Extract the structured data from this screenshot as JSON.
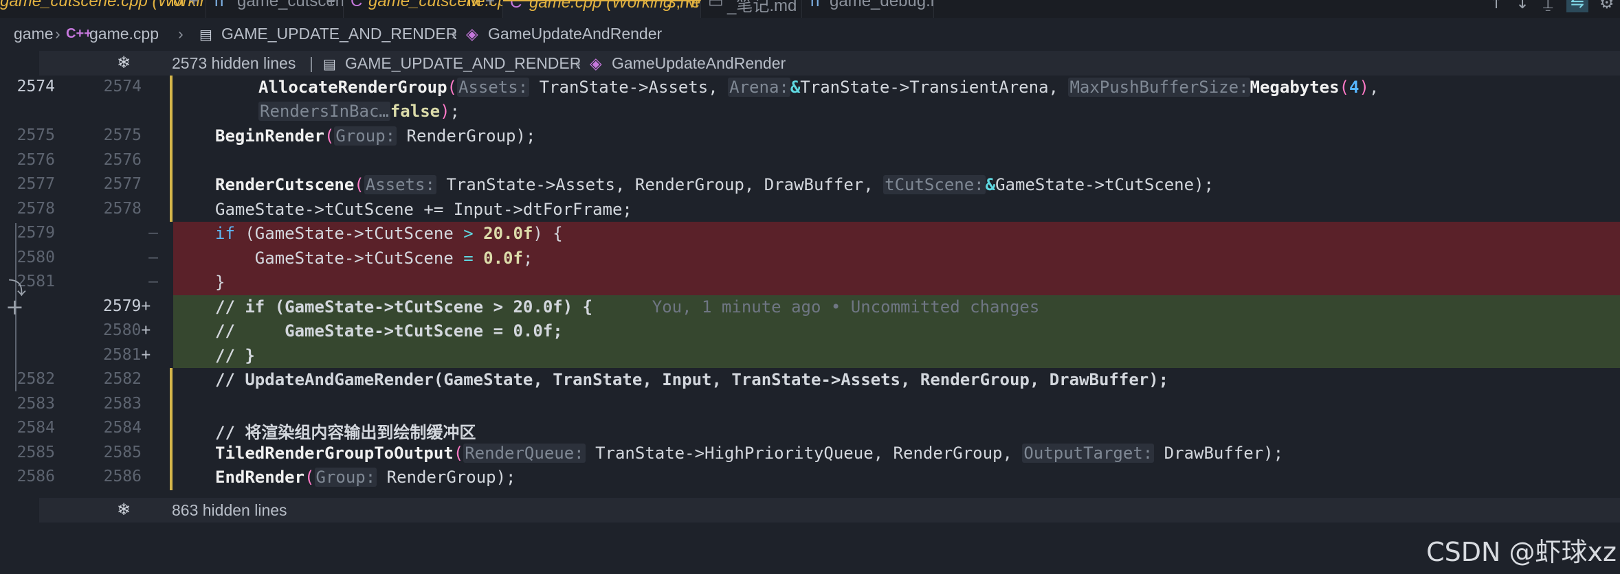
{
  "tabs": [
    {
      "name": "game_cutscene.cpp (Working Tree)",
      "flag": "M"
    },
    {
      "name": "game_cutscene.h"
    },
    {
      "name": "game_cutscene.cpp",
      "flag": "M"
    },
    {
      "name": "game.cpp (Working Tree)",
      "flag": "3, M"
    },
    {
      "name": "_笔记.md"
    },
    {
      "name": "game_debug.h"
    }
  ],
  "breadcrumb": {
    "folder": "game",
    "file": "game.cpp",
    "file_icon": "C++",
    "namespace": "GAME_UPDATE_AND_RENDER",
    "function": "GameUpdateAndRender"
  },
  "hidden_top": {
    "text": "2573 hidden lines",
    "sep": "|",
    "namespace": "GAME_UPDATE_AND_RENDER",
    "function": "GameUpdateAndRender"
  },
  "hidden_bottom": {
    "text": "863 hidden lines"
  },
  "lines": [
    {
      "old": "2574",
      "new": "2574",
      "code_a": "AllocateRenderGroup",
      "hint_a": "Assets:",
      "code_b": " TranState->Assets, ",
      "hint_b": "Arena:",
      "ref_b": "&",
      "code_c": "TranState->TransientArena, ",
      "hint_c": "MaxPushBufferSize:",
      "code_d": "Megabytes",
      "num_d": "4",
      "wrap_hint": "RendersInBac…",
      "wrap_kw": "false"
    },
    {
      "old": "2575",
      "new": "2575",
      "fn": "BeginRender",
      "hint": "Group:",
      "rest": " RenderGroup);"
    },
    {
      "old": "2576",
      "new": "2576"
    },
    {
      "old": "2577",
      "new": "2577",
      "fn": "RenderCutscene",
      "hint": "Assets:",
      "mid": " TranState->Assets, RenderGroup, DrawBuffer, ",
      "hint2": "tCutScene:",
      "ref": "&",
      "rest": "GameState->tCutScene);"
    },
    {
      "old": "2578",
      "new": "2578",
      "text": "GameState->tCutScene += Input->dtForFrame;"
    },
    {
      "old": "2579",
      "new": "—",
      "kw": "if",
      "text_a": " (GameState->tCutScene ",
      "op": ">",
      "num": "20.0f",
      "text_b": ") {"
    },
    {
      "old": "2580",
      "new": "—",
      "text_a": "    GameState->tCutScene ",
      "op": "=",
      "num": "0.0f",
      "text_b": ";"
    },
    {
      "old": "2581",
      "new": "—",
      "text": "}"
    },
    {
      "old": "",
      "new": "2579",
      "marker": "+",
      "text": "// if (GameState->tCutScene > 20.0f) {",
      "blame": "You, 1 minute ago • Uncommitted changes"
    },
    {
      "old": "",
      "new": "2580",
      "marker": "+",
      "text": "//     GameState->tCutScene = 0.0f;"
    },
    {
      "old": "",
      "new": "2581",
      "marker": "+",
      "text": "// }"
    },
    {
      "old": "2582",
      "new": "2582",
      "text": "// UpdateAndGameRender(GameState, TranState, Input, TranState->Assets, RenderGroup, DrawBuffer);"
    },
    {
      "old": "2583",
      "new": "2583"
    },
    {
      "old": "2584",
      "new": "2584",
      "text": "// 将渲染组内容输出到绘制缓冲区"
    },
    {
      "old": "2585",
      "new": "2585",
      "fn": "TiledRenderGroupToOutput",
      "hint": "RenderQueue:",
      "mid": " TranState->HighPriorityQueue, RenderGroup, ",
      "hint2": "OutputTarget:",
      "rest": " DrawBuffer);"
    },
    {
      "old": "2586",
      "new": "2586",
      "fn": "EndRender",
      "hint": "Group:",
      "rest": " RenderGroup);"
    }
  ],
  "watermark": "CSDN @虾球xz",
  "colors": {
    "deleted_bg": "#5a2129",
    "added_bg": "#36472f",
    "modified_gutter": "#d4b54a",
    "tab_modified": "#e3b341"
  }
}
